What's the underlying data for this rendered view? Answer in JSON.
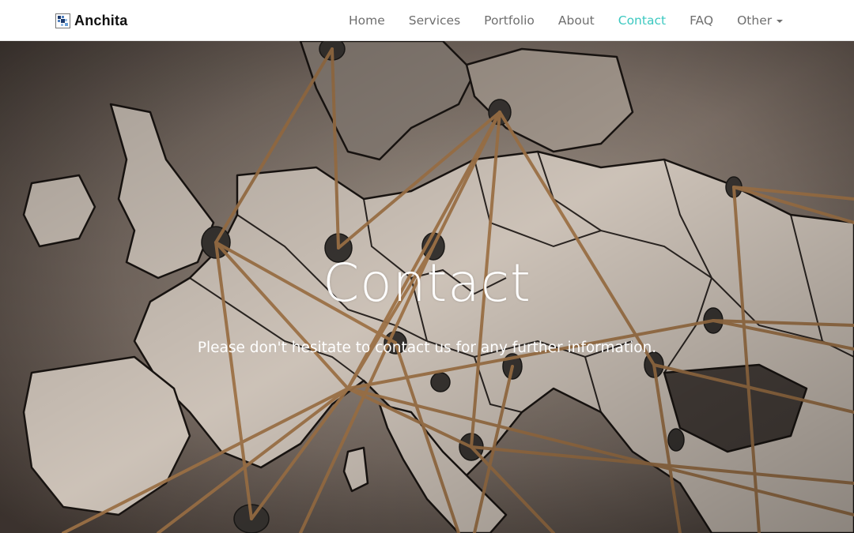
{
  "brand": {
    "name": "Anchita",
    "logo_icon": "anchita-logo-icon"
  },
  "nav": {
    "items": [
      {
        "label": "Home"
      },
      {
        "label": "Services"
      },
      {
        "label": "Portfolio"
      },
      {
        "label": "About"
      },
      {
        "label": "Contact"
      },
      {
        "label": "FAQ"
      },
      {
        "label": "Other"
      }
    ],
    "active_item": "Contact",
    "dropdown_item": "Other",
    "active_color": "#3cc8c0"
  },
  "hero": {
    "title": "Contact",
    "subtitle": "Please don't hesitate to contact us for any further information.",
    "background": "map-of-europe-with-pins-and-string"
  }
}
